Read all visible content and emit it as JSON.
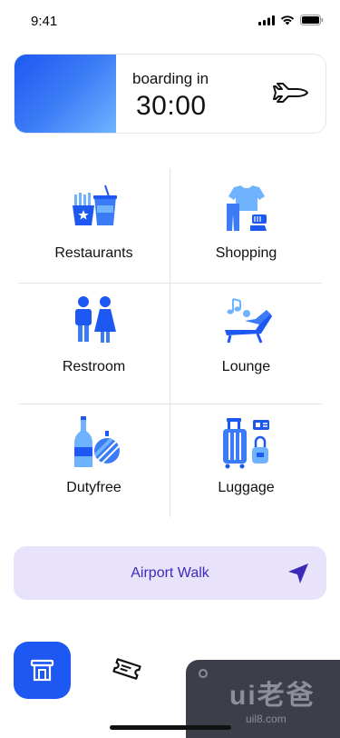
{
  "status": {
    "time": "9:41",
    "icons": [
      "signal-icon",
      "wifi-icon",
      "battery-icon"
    ]
  },
  "boarding": {
    "label": "boarding in",
    "time": "30:00",
    "icon": "airplane-icon"
  },
  "categories": [
    {
      "label": "Restaurants",
      "icon": "restaurant-icon"
    },
    {
      "label": "Shopping",
      "icon": "shopping-icon"
    },
    {
      "label": "Restroom",
      "icon": "restroom-icon"
    },
    {
      "label": "Lounge",
      "icon": "lounge-icon"
    },
    {
      "label": "Dutyfree",
      "icon": "dutyfree-icon"
    },
    {
      "label": "Luggage",
      "icon": "luggage-icon"
    }
  ],
  "walk": {
    "label": "Airport Walk",
    "icon": "navigation-arrow-icon"
  },
  "nav": {
    "items": [
      "home-icon",
      "ticket-icon"
    ]
  },
  "watermark": {
    "logo": "ui老爸",
    "url": "uil8.com"
  },
  "colors": {
    "accent": "#1e58f2",
    "light_blue": "#6fb3ff",
    "walk_bg": "#e8e3fb",
    "walk_text": "#3b2bb8"
  }
}
